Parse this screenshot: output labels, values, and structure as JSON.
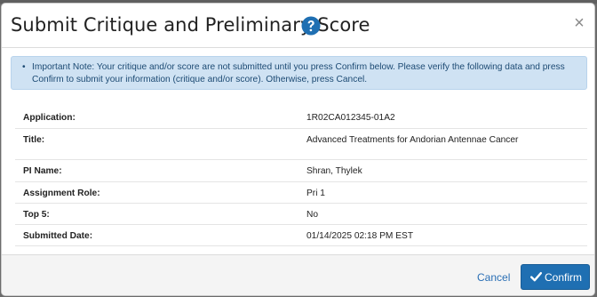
{
  "modal": {
    "title": "Submit Critique and Preliminary Score",
    "help_icon": "question-circle-icon",
    "close_icon": "close-icon",
    "close_glyph": "×",
    "alert": {
      "bullet": "•",
      "text": "Important Note: Your critique and/or score are not submitted until you press Confirm below. Please verify the following data and press Confirm to submit your information (critique and/or score). Otherwise, press Cancel."
    },
    "details": [
      {
        "label": "Application:",
        "value": "1R02CA012345-01A2"
      },
      {
        "label": "Title:",
        "value": "Advanced Treatments for Andorian Antennae Cancer"
      },
      {
        "label": "PI Name:",
        "value": "Shran, Thylek"
      },
      {
        "label": "Assignment Role:",
        "value": "Pri 1"
      },
      {
        "label": "Top 5:",
        "value": "No"
      },
      {
        "label": "Submitted Date:",
        "value": "01/14/2025 02:18 PM EST"
      }
    ],
    "footer": {
      "cancel_label": "Cancel",
      "confirm_label": "Confirm",
      "confirm_icon": "check-icon"
    }
  },
  "colors": {
    "primary": "#1f6fb2",
    "link": "#2a6fb5",
    "alert_bg": "#cfe2f3",
    "alert_text": "#1c4a73"
  }
}
